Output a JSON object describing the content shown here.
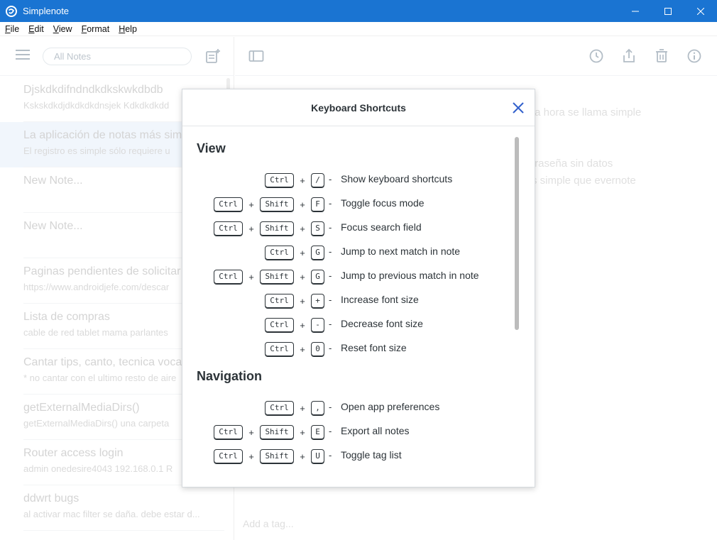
{
  "window": {
    "title": "Simplenote"
  },
  "menu": [
    {
      "accel": "F",
      "rest": "ile"
    },
    {
      "accel": "E",
      "rest": "dit"
    },
    {
      "accel": "V",
      "rest": "iew"
    },
    {
      "accel": "F",
      "rest": "ormat"
    },
    {
      "accel": "H",
      "rest": "elp"
    }
  ],
  "sidebar": {
    "search_placeholder": "All Notes",
    "notes": [
      {
        "title": "Djskdkdifndndkdkskwkdbdb",
        "preview": "Kskskdkdjdkdkdkdnsjek Kdkdkdkdd",
        "selected": false
      },
      {
        "title": "La aplicación de notas más simple",
        "preview": "El registro es simple sólo requiere u",
        "selected": true
      },
      {
        "title": "New Note...",
        "preview": "",
        "selected": false
      },
      {
        "title": "New Note...",
        "preview": "",
        "selected": false
      },
      {
        "title": "Paginas pendientes de solicitar",
        "preview": "https://www.androidjefe.com/descar",
        "selected": false
      },
      {
        "title": "Lista de compras",
        "preview": "cable de red tablet mama parlantes",
        "selected": false
      },
      {
        "title": "Cantar tips, canto, tecnica vocal",
        "preview": "* no cantar con el ultimo resto de aire",
        "selected": false
      },
      {
        "title": "getExternalMediaDirs()",
        "preview": "getExternalMediaDirs() una carpeta",
        "selected": false
      },
      {
        "title": "Router access login",
        "preview": "admin onedesire4043 192.168.0.1 R",
        "selected": false
      },
      {
        "title": "ddwrt bugs",
        "preview": "al activar mac filter se daña. debe estar d...",
        "selected": false
      }
    ]
  },
  "editor": {
    "line1": "ta hora se llama simple",
    "line2": "traseña sin datos",
    "line3": "s simple que evernote",
    "add_tag_placeholder": "Add a tag..."
  },
  "dialog": {
    "title": "Keyboard Shortcuts",
    "sections": [
      {
        "heading": "View",
        "shortcuts": [
          {
            "keys": [
              "Ctrl",
              "/"
            ],
            "desc": "Show keyboard shortcuts"
          },
          {
            "keys": [
              "Ctrl",
              "Shift",
              "F"
            ],
            "desc": "Toggle focus mode"
          },
          {
            "keys": [
              "Ctrl",
              "Shift",
              "S"
            ],
            "desc": "Focus search field"
          },
          {
            "keys": [
              "Ctrl",
              "G"
            ],
            "desc": "Jump to next match in note"
          },
          {
            "keys": [
              "Ctrl",
              "Shift",
              "G"
            ],
            "desc": "Jump to previous match in note"
          },
          {
            "keys": [
              "Ctrl",
              "+"
            ],
            "desc": "Increase font size"
          },
          {
            "keys": [
              "Ctrl",
              "-"
            ],
            "desc": "Decrease font size"
          },
          {
            "keys": [
              "Ctrl",
              "0"
            ],
            "desc": "Reset font size"
          }
        ]
      },
      {
        "heading": "Navigation",
        "shortcuts": [
          {
            "keys": [
              "Ctrl",
              ","
            ],
            "desc": "Open app preferences"
          },
          {
            "keys": [
              "Ctrl",
              "Shift",
              "E"
            ],
            "desc": "Export all notes"
          },
          {
            "keys": [
              "Ctrl",
              "Shift",
              "U"
            ],
            "desc": "Toggle tag list"
          }
        ]
      }
    ],
    "plus_sign": "+",
    "separator": "-"
  },
  "icons": {
    "app": "simplenote-logo-icon",
    "sidebar_menu": "hamburger-menu-icon",
    "new_note": "new-note-icon",
    "toggle_sidebar": "sidebar-toggle-icon",
    "history": "history-icon",
    "share": "share-icon",
    "trash": "trash-icon",
    "info": "info-icon",
    "close": "close-icon"
  },
  "colors": {
    "titlebar": "#1a74d2",
    "accent": "#3361cc",
    "selected_note": "#eaf1fb",
    "text": "#2c3338"
  }
}
